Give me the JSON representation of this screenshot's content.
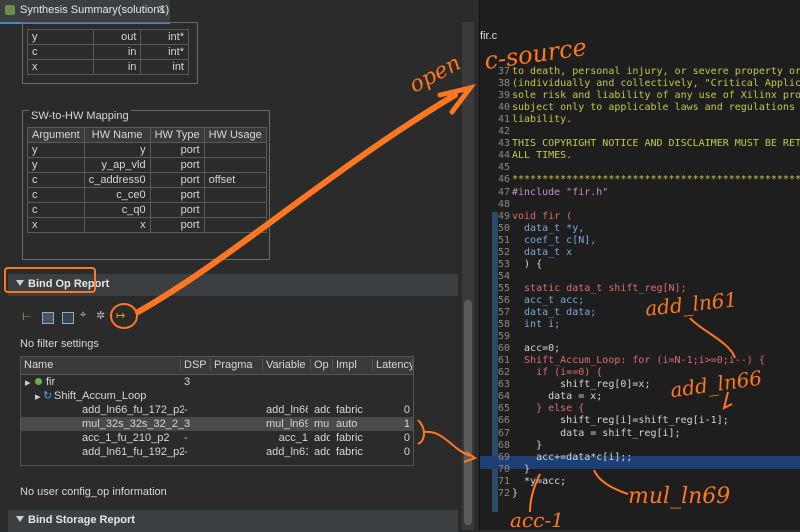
{
  "tab": {
    "title": "Synthesis Summary(solution1)"
  },
  "ports_table": {
    "rows": [
      [
        "y",
        "out",
        "int*"
      ],
      [
        "c",
        "in",
        "int*"
      ],
      [
        "x",
        "in",
        "int"
      ]
    ]
  },
  "mapping": {
    "title": "SW-to-HW Mapping",
    "headers": [
      "Argument",
      "HW Name",
      "HW Type",
      "HW Usage"
    ],
    "rows": [
      [
        "y",
        "y",
        "port",
        ""
      ],
      [
        "y",
        "y_ap_vld",
        "port",
        ""
      ],
      [
        "c",
        "c_address0",
        "port",
        "offset"
      ],
      [
        "c",
        "c_ce0",
        "port",
        ""
      ],
      [
        "c",
        "c_q0",
        "port",
        ""
      ],
      [
        "x",
        "x",
        "port",
        ""
      ]
    ]
  },
  "bind_op": {
    "title": "Bind Op Report",
    "filter": "No filter settings",
    "headers": [
      "Name",
      "DSP",
      "Pragma",
      "Variable",
      "Op",
      "Impl",
      "Latency"
    ],
    "rows": [
      {
        "name": "fir",
        "dsp": "3",
        "pragma": "",
        "variable": "",
        "op": "",
        "impl": "",
        "latency": ""
      },
      {
        "name": "Shift_Accum_Loop",
        "dsp": "",
        "pragma": "",
        "variable": "",
        "op": "",
        "impl": "",
        "latency": ""
      },
      {
        "name": "add_ln66_fu_172_p2",
        "dsp": "-",
        "pragma": "",
        "variable": "add_ln66",
        "op": "add",
        "impl": "fabric",
        "latency": "0"
      },
      {
        "name": "mul_32s_32s_32_2_1_U1",
        "dsp": "3",
        "pragma": "",
        "variable": "mul_ln69",
        "op": "mul",
        "impl": "auto",
        "latency": "1"
      },
      {
        "name": "acc_1_fu_210_p2",
        "dsp": "-",
        "pragma": "",
        "variable": "acc_1",
        "op": "add",
        "impl": "fabric",
        "latency": "0"
      },
      {
        "name": "add_ln61_fu_192_p2",
        "dsp": "-",
        "pragma": "",
        "variable": "add_ln61",
        "op": "add",
        "impl": "fabric",
        "latency": "0"
      }
    ],
    "footer": "No user config_op information"
  },
  "bind_storage": {
    "title": "Bind Storage Report"
  },
  "editor": {
    "file": "fir.c",
    "lines": [
      {
        "n": "37",
        "t": "to death, personal injury, or severe property or en"
      },
      {
        "n": "38",
        "t": "(individually and collectively, \"Critical Applicati"
      },
      {
        "n": "39",
        "t": "sole risk and liability of any use of Xilinx produ"
      },
      {
        "n": "40",
        "t": "subject only to applicable laws and regulations gov"
      },
      {
        "n": "41",
        "t": "liability."
      },
      {
        "n": "42",
        "t": ""
      },
      {
        "n": "43",
        "t": "THIS COPYRIGHT NOTICE AND DISCLAIMER MUST BE RETAINE"
      },
      {
        "n": "44",
        "t": "ALL TIMES."
      },
      {
        "n": "45",
        "t": ""
      },
      {
        "n": "46",
        "t": "************************************************"
      },
      {
        "n": "47",
        "t": "#include \"fir.h\""
      },
      {
        "n": "48",
        "t": ""
      },
      {
        "n": "49",
        "t": "void fir ("
      },
      {
        "n": "50",
        "t": "  data_t *y,"
      },
      {
        "n": "51",
        "t": "  coef_t c[N],"
      },
      {
        "n": "52",
        "t": "  data_t x"
      },
      {
        "n": "53",
        "t": "  ) {"
      },
      {
        "n": "54",
        "t": ""
      },
      {
        "n": "55",
        "t": "  static data_t shift_reg[N];"
      },
      {
        "n": "56",
        "t": "  acc_t acc;"
      },
      {
        "n": "57",
        "t": "  data_t data;"
      },
      {
        "n": "58",
        "t": "  int i;"
      },
      {
        "n": "59",
        "t": ""
      },
      {
        "n": "60",
        "t": "  acc=0;"
      },
      {
        "n": "61",
        "t": "  Shift_Accum_Loop: for (i=N-1;i>=0;i--) {"
      },
      {
        "n": "62",
        "t": "    if (i==0) {"
      },
      {
        "n": "63",
        "t": "        shift_reg[0]=x;"
      },
      {
        "n": "64",
        "t": "      data = x;"
      },
      {
        "n": "65",
        "t": "    } else {"
      },
      {
        "n": "66",
        "t": "        shift_reg[i]=shift_reg[i-1];"
      },
      {
        "n": "67",
        "t": "        data = shift_reg[i];"
      },
      {
        "n": "68",
        "t": "    }"
      },
      {
        "n": "69",
        "t": "    acc+=data*c[i];;"
      },
      {
        "n": "70",
        "t": "  }"
      },
      {
        "n": "71",
        "t": "  *y=acc;"
      },
      {
        "n": "72",
        "t": "}"
      }
    ]
  },
  "annotations": {
    "open": "open",
    "c_source": "c-source",
    "add_ln61": "add_ln61",
    "add_ln66": "add_ln66",
    "mul_ln69": "mul_ln69",
    "acc_1": "acc-1"
  },
  "colors": {
    "annotation": "#ff7722",
    "selection": "#1d3f75"
  }
}
